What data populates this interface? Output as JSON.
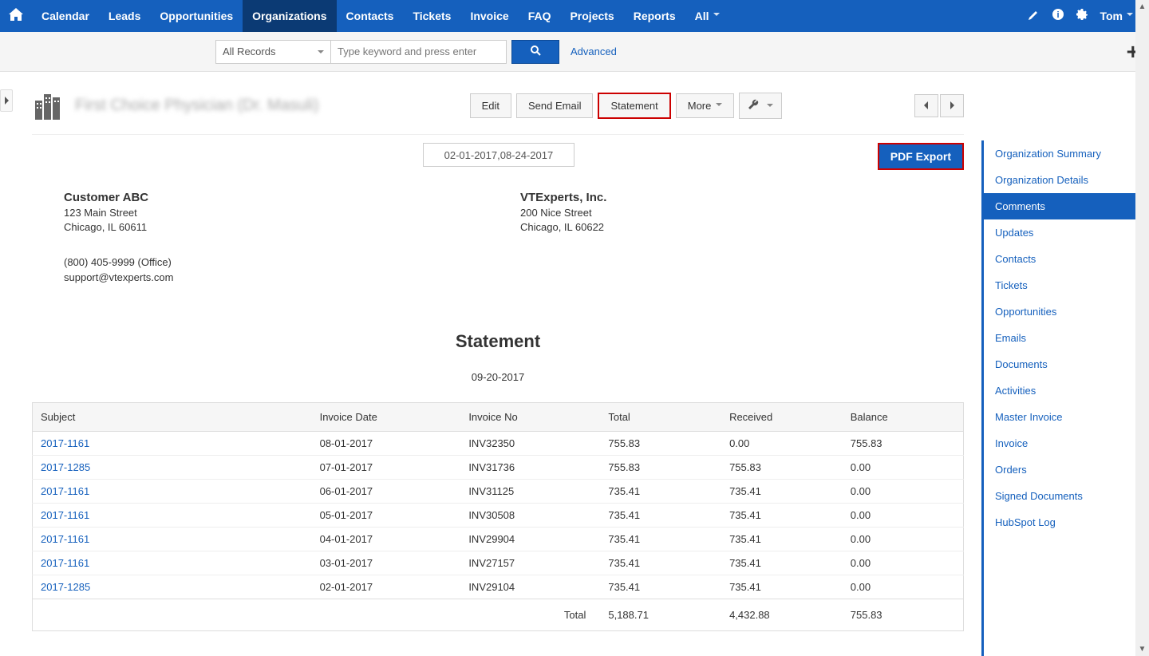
{
  "nav": {
    "items": [
      "Calendar",
      "Leads",
      "Opportunities",
      "Organizations",
      "Contacts",
      "Tickets",
      "Invoice",
      "FAQ",
      "Projects",
      "Reports",
      "All"
    ],
    "active": "Organizations",
    "user": "Tom"
  },
  "search": {
    "all_records": "All Records",
    "placeholder": "Type keyword and press enter",
    "advanced": "Advanced"
  },
  "header": {
    "title": "First Choice Physician (Dr. Masuli)",
    "actions": {
      "edit": "Edit",
      "send_email": "Send Email",
      "statement": "Statement",
      "more": "More"
    }
  },
  "statement": {
    "date_range": "02-01-2017,08-24-2017",
    "pdf_export": "PDF Export",
    "customer": {
      "name": "Customer ABC",
      "street": "123 Main Street",
      "city": "Chicago, IL 60611"
    },
    "company": {
      "name": "VTExperts, Inc.",
      "street": "200 Nice Street",
      "city": "Chicago, IL 60622"
    },
    "phone": "(800) 405-9999 (Office)",
    "email": "support@vtexperts.com",
    "title": "Statement",
    "date": "09-20-2017",
    "columns": [
      "Subject",
      "Invoice Date",
      "Invoice No",
      "Total",
      "Received",
      "Balance"
    ],
    "rows": [
      {
        "subject": "2017-1161",
        "date": "08-01-2017",
        "no": "INV32350",
        "total": "755.83",
        "received": "0.00",
        "balance": "755.83"
      },
      {
        "subject": "2017-1285",
        "date": "07-01-2017",
        "no": "INV31736",
        "total": "755.83",
        "received": "755.83",
        "balance": "0.00"
      },
      {
        "subject": "2017-1161",
        "date": "06-01-2017",
        "no": "INV31125",
        "total": "735.41",
        "received": "735.41",
        "balance": "0.00"
      },
      {
        "subject": "2017-1161",
        "date": "05-01-2017",
        "no": "INV30508",
        "total": "735.41",
        "received": "735.41",
        "balance": "0.00"
      },
      {
        "subject": "2017-1161",
        "date": "04-01-2017",
        "no": "INV29904",
        "total": "735.41",
        "received": "735.41",
        "balance": "0.00"
      },
      {
        "subject": "2017-1161",
        "date": "03-01-2017",
        "no": "INV27157",
        "total": "735.41",
        "received": "735.41",
        "balance": "0.00"
      },
      {
        "subject": "2017-1285",
        "date": "02-01-2017",
        "no": "INV29104",
        "total": "735.41",
        "received": "735.41",
        "balance": "0.00"
      }
    ],
    "total_label": "Total",
    "totals": {
      "total": "5,188.71",
      "received": "4,432.88",
      "balance": "755.83"
    }
  },
  "sidebar": {
    "items": [
      "Organization Summary",
      "Organization Details",
      "Comments",
      "Updates",
      "Contacts",
      "Tickets",
      "Opportunities",
      "Emails",
      "Documents",
      "Activities",
      "Master Invoice",
      "Invoice",
      "Orders",
      "Signed Documents",
      "HubSpot Log"
    ],
    "active": "Comments"
  }
}
